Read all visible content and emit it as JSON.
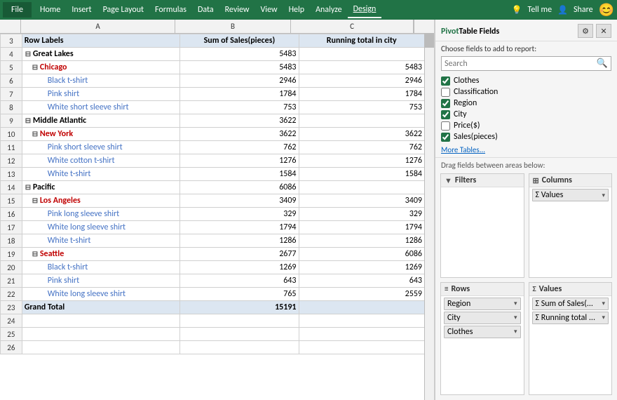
{
  "menuBar": {
    "file": "File",
    "items": [
      "Home",
      "Insert",
      "Page Layout",
      "Formulas",
      "Data",
      "Review",
      "View",
      "Help",
      "Analyze",
      "Design"
    ],
    "tellme": "Tell me",
    "share": "Share",
    "smiley": "😊"
  },
  "columns": {
    "rowNum": "",
    "a": "A",
    "b": "B",
    "c": "C"
  },
  "rows": [
    {
      "num": "3",
      "a": "Row Labels",
      "b": "Sum of Sales(pieces)",
      "c": "Running total in city",
      "type": "header"
    },
    {
      "num": "4",
      "a": "⊟ Great Lakes",
      "b": "5483",
      "c": "",
      "type": "region"
    },
    {
      "num": "5",
      "a": "  ⊟ Chicago",
      "b": "5483",
      "c": "5483",
      "type": "city"
    },
    {
      "num": "6",
      "a": "      Black t-shirt",
      "b": "2946",
      "c": "2946",
      "type": "item"
    },
    {
      "num": "7",
      "a": "      Pink shirt",
      "b": "1784",
      "c": "1784",
      "type": "item"
    },
    {
      "num": "8",
      "a": "      White short sleeve shirt",
      "b": "753",
      "c": "753",
      "type": "item"
    },
    {
      "num": "9",
      "a": "⊟ Middle Atlantic",
      "b": "3622",
      "c": "",
      "type": "region"
    },
    {
      "num": "10",
      "a": "  ⊟ New York",
      "b": "3622",
      "c": "3622",
      "type": "city"
    },
    {
      "num": "11",
      "a": "      Pink short sleeve shirt",
      "b": "762",
      "c": "762",
      "type": "item"
    },
    {
      "num": "12",
      "a": "      White cotton t-shirt",
      "b": "1276",
      "c": "1276",
      "type": "item"
    },
    {
      "num": "13",
      "a": "      White t-shirt",
      "b": "1584",
      "c": "1584",
      "type": "item"
    },
    {
      "num": "14",
      "a": "⊟ Pacific",
      "b": "6086",
      "c": "",
      "type": "region"
    },
    {
      "num": "15",
      "a": "  ⊟ Los Angeles",
      "b": "3409",
      "c": "3409",
      "type": "city"
    },
    {
      "num": "16",
      "a": "      Pink long sleeve shirt",
      "b": "329",
      "c": "329",
      "type": "item"
    },
    {
      "num": "17",
      "a": "      White long sleeve shirt",
      "b": "1794",
      "c": "1794",
      "type": "item"
    },
    {
      "num": "18",
      "a": "      White t-shirt",
      "b": "1286",
      "c": "1286",
      "type": "item"
    },
    {
      "num": "19",
      "a": "  ⊟ Seattle",
      "b": "2677",
      "c": "6086",
      "type": "city"
    },
    {
      "num": "20",
      "a": "      Black t-shirt",
      "b": "1269",
      "c": "1269",
      "type": "item"
    },
    {
      "num": "21",
      "a": "      Pink shirt",
      "b": "643",
      "c": "643",
      "type": "item"
    },
    {
      "num": "22",
      "a": "      White long sleeve shirt",
      "b": "765",
      "c": "2559",
      "type": "item"
    },
    {
      "num": "23",
      "a": "Grand Total",
      "b": "15191",
      "c": "",
      "type": "grand"
    },
    {
      "num": "24",
      "a": "",
      "b": "",
      "c": "",
      "type": "empty"
    },
    {
      "num": "25",
      "a": "",
      "b": "",
      "c": "",
      "type": "empty"
    },
    {
      "num": "26",
      "a": "",
      "b": "",
      "c": "",
      "type": "empty"
    }
  ],
  "pivotPanel": {
    "title": "PivotTable Fields",
    "chooseLabel": "Choose fields to add to report:",
    "searchPlaceholder": "Search",
    "fields": [
      {
        "name": "Clothes",
        "checked": true
      },
      {
        "name": "Classification",
        "checked": false
      },
      {
        "name": "Region",
        "checked": true
      },
      {
        "name": "City",
        "checked": true
      },
      {
        "name": "Price($)",
        "checked": false
      },
      {
        "name": "Sales(pieces)",
        "checked": true
      }
    ],
    "moreTables": "More Tables...",
    "dragLabel": "Drag fields between areas below:",
    "areas": {
      "filters": {
        "header": "Filters",
        "items": []
      },
      "columns": {
        "header": "Columns",
        "items": [
          "Values"
        ]
      },
      "rows": {
        "header": "Rows",
        "items": [
          "Region",
          "City",
          "Clothes"
        ]
      },
      "values": {
        "header": "Values",
        "items": [
          "Sum of Sales(...",
          "Running total ..."
        ]
      }
    }
  }
}
